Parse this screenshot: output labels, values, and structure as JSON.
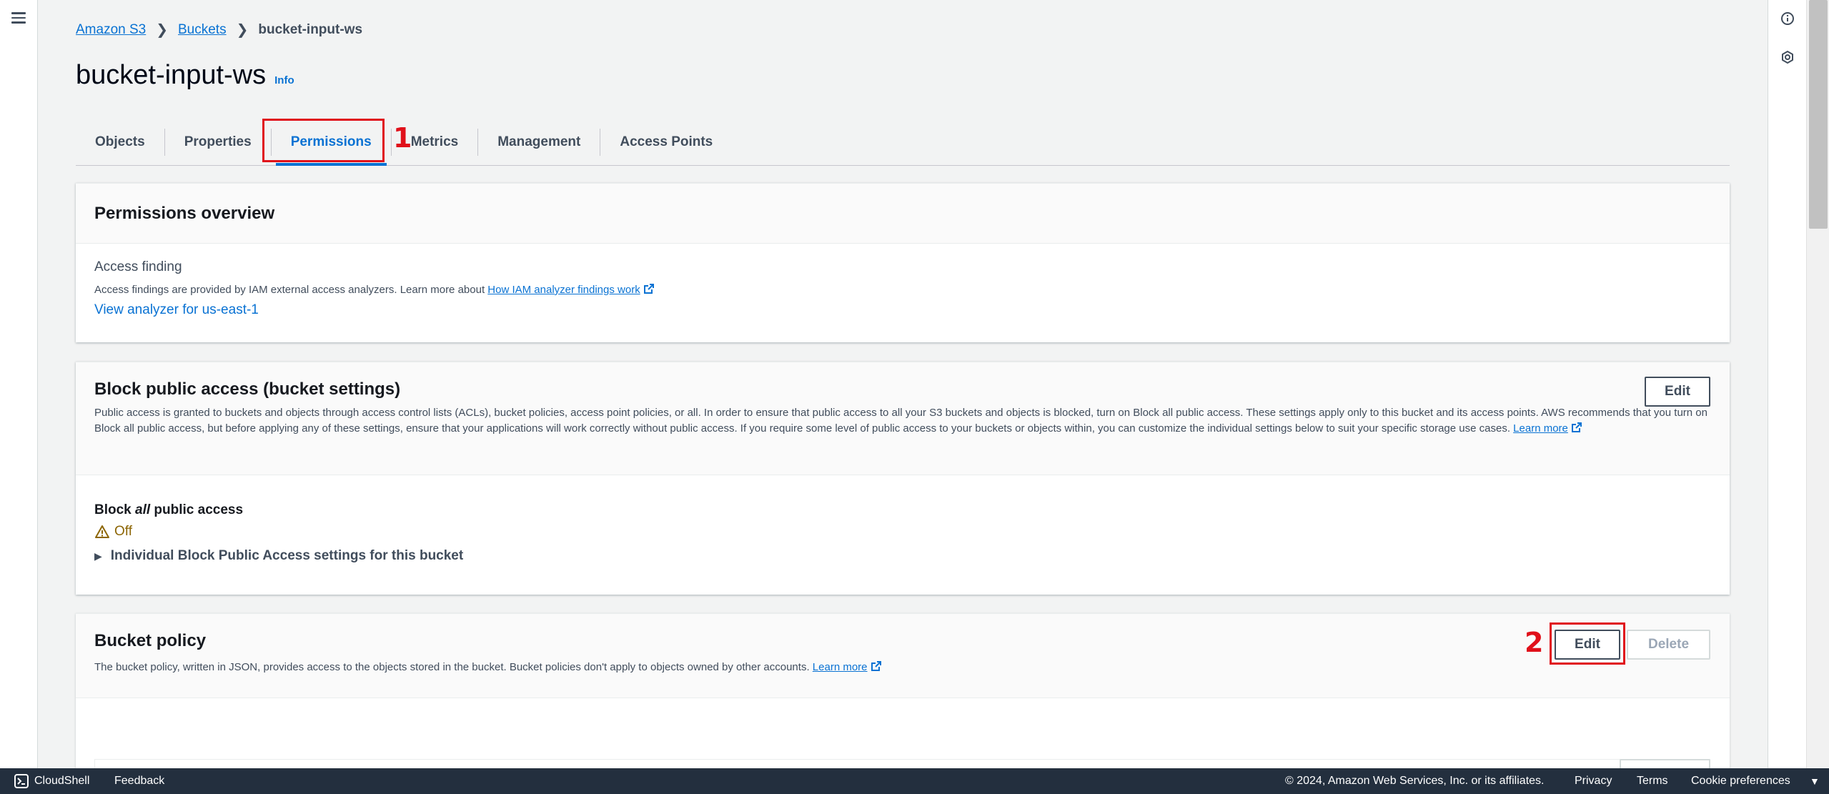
{
  "breadcrumb": {
    "items": [
      "Amazon S3",
      "Buckets"
    ],
    "current": "bucket-input-ws"
  },
  "page": {
    "title": "bucket-input-ws",
    "info": "Info"
  },
  "tabs": [
    {
      "label": "Objects"
    },
    {
      "label": "Properties"
    },
    {
      "label": "Permissions"
    },
    {
      "label": "Metrics"
    },
    {
      "label": "Management"
    },
    {
      "label": "Access Points"
    }
  ],
  "annotations": {
    "one": "1",
    "two": "2"
  },
  "permissions_overview": {
    "title": "Permissions overview",
    "access_finding_label": "Access finding",
    "access_finding_desc": "Access findings are provided by IAM external access analyzers. Learn more about",
    "access_finding_link": "How IAM analyzer findings work",
    "analyzer_link": "View analyzer for us-east-1"
  },
  "block_public_access": {
    "title": "Block public access (bucket settings)",
    "edit_label": "Edit",
    "desc": "Public access is granted to buckets and objects through access control lists (ACLs), bucket policies, access point policies, or all. In order to ensure that public access to all your S3 buckets and objects is blocked, turn on Block all public access. These settings apply only to this bucket and its access points. AWS recommends that you turn on Block all public access, but before applying any of these settings, ensure that your applications will work correctly without public access. If you require some level of public access to your buckets or objects within, you can customize the individual settings below to suit your specific storage use cases.",
    "learn_more": "Learn more",
    "block_all_prefix": "Block ",
    "block_all_em": "all",
    "block_all_suffix": " public access",
    "status": "Off",
    "individual_label": "Individual Block Public Access settings for this bucket"
  },
  "bucket_policy": {
    "title": "Bucket policy",
    "desc": "The bucket policy, written in JSON, provides access to the objects stored in the bucket. Bucket policies don't apply to objects owned by other accounts.",
    "learn_more": "Learn more",
    "edit_label": "Edit",
    "delete_label": "Delete"
  },
  "footer": {
    "cloudshell": "CloudShell",
    "feedback": "Feedback",
    "copyright": "© 2024, Amazon Web Services, Inc. or its affiliates.",
    "privacy": "Privacy",
    "terms": "Terms",
    "cookie": "Cookie preferences"
  },
  "colors": {
    "link": "#0972d3",
    "annotation": "#e0101a",
    "warning": "#8d6605",
    "footer_bg": "#232f3e"
  }
}
